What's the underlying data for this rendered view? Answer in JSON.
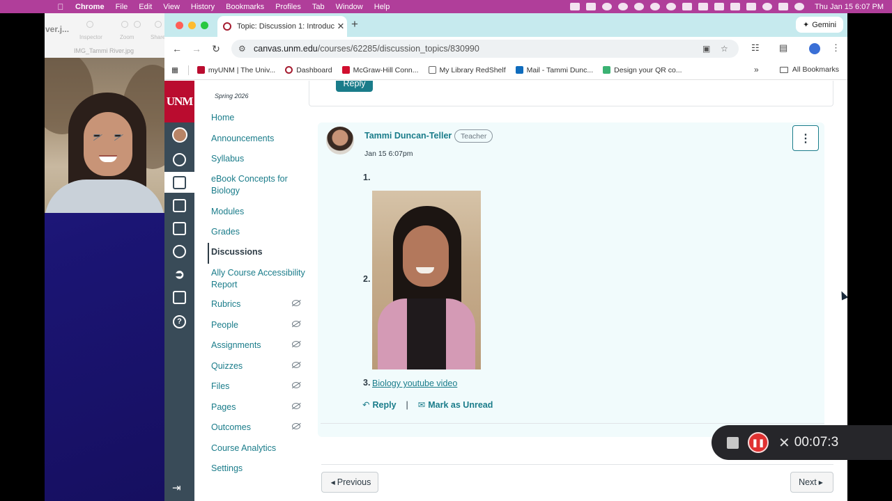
{
  "menubar": {
    "app": "Chrome",
    "items": [
      "File",
      "Edit",
      "View",
      "History",
      "Bookmarks",
      "Profiles",
      "Tab",
      "Window",
      "Help"
    ],
    "clock": "Thu Jan 15  6:07 PM"
  },
  "preview": {
    "filename_partial": "ver.j...",
    "tools": [
      "Inspector",
      "Zoom",
      "Share"
    ],
    "file_title": "IMG_Tammi River.jpg"
  },
  "browser": {
    "tab_title": "Topic: Discussion 1: Introduc",
    "gemini_label": "Gemini",
    "url_host": "canvas.unm.edu",
    "url_path": "/courses/62285/discussion_topics/830990",
    "bookmarks": [
      {
        "label": "myUNM | The Univ...",
        "color": "#ba0c2f"
      },
      {
        "label": "Dashboard",
        "color": "#a51c30"
      },
      {
        "label": "McGraw-Hill Conn...",
        "color": "#d10f2f"
      },
      {
        "label": "My Library RedShelf",
        "color": "#666666"
      },
      {
        "label": "Mail - Tammi Dunc...",
        "color": "#0f6cbd"
      },
      {
        "label": "Design your QR co...",
        "color": "#3bb273"
      }
    ],
    "all_bookmarks": "All Bookmarks"
  },
  "canvas": {
    "logo": "UNM",
    "term": "Spring 2026",
    "course_nav": [
      {
        "label": "Home",
        "hidden": false
      },
      {
        "label": "Announcements",
        "hidden": false
      },
      {
        "label": "Syllabus",
        "hidden": false
      },
      {
        "label": "eBook Concepts for Biology",
        "hidden": false
      },
      {
        "label": "Modules",
        "hidden": false
      },
      {
        "label": "Grades",
        "hidden": false
      },
      {
        "label": "Discussions",
        "hidden": false,
        "active": true
      },
      {
        "label": "Ally Course Accessibility Report",
        "hidden": false
      },
      {
        "label": "Rubrics",
        "hidden": true
      },
      {
        "label": "People",
        "hidden": true
      },
      {
        "label": "Assignments",
        "hidden": true
      },
      {
        "label": "Quizzes",
        "hidden": true
      },
      {
        "label": "Files",
        "hidden": true
      },
      {
        "label": "Pages",
        "hidden": true
      },
      {
        "label": "Outcomes",
        "hidden": true
      },
      {
        "label": "Course Analytics",
        "hidden": false
      },
      {
        "label": "Settings",
        "hidden": false
      }
    ],
    "top_reply": "Reply",
    "entry": {
      "author": "Tammi Duncan-Teller",
      "role": "Teacher",
      "date": "Jan 15 6:07pm",
      "list_numbers": [
        "1.",
        "2.",
        "3."
      ],
      "link_text": "Biology youtube video",
      "reply_label": "Reply",
      "separator": "|",
      "mark_unread_label": "Mark as Unread"
    },
    "pager": {
      "previous": "Previous",
      "next": "Next"
    }
  },
  "recorder": {
    "time": "00:07:3"
  },
  "colors": {
    "canvas_link": "#1a7c8a",
    "unm_red": "#ba0c2f",
    "global_nav": "#394b58",
    "menubar": "#b03e9a"
  }
}
